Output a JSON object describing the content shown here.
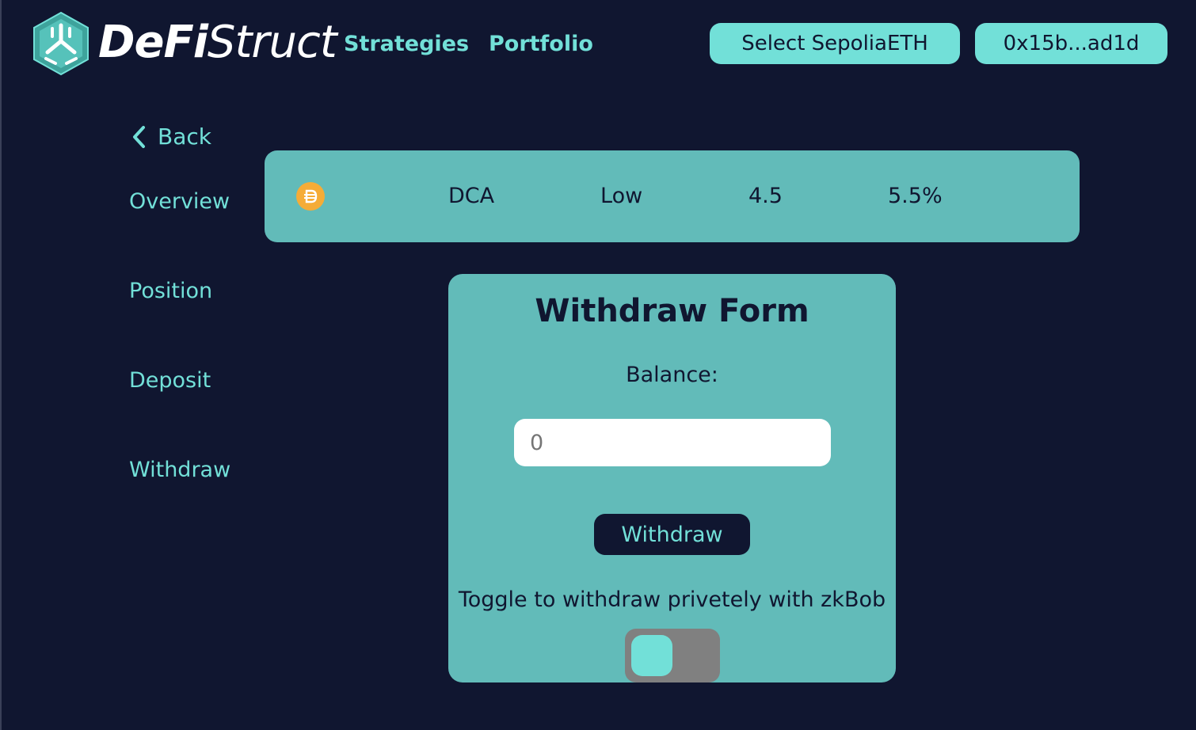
{
  "header": {
    "brand_bold": "DeFi",
    "brand_light": "Struct",
    "nav": {
      "strategies": "Strategies",
      "portfolio": "Portfolio"
    },
    "network_button": "Select SepoliaETH",
    "wallet_button": "0x15b...ad1d"
  },
  "sidebar": {
    "back": "Back",
    "items": [
      {
        "label": "Overview"
      },
      {
        "label": "Position"
      },
      {
        "label": "Deposit"
      },
      {
        "label": "Withdraw"
      }
    ]
  },
  "strategy": {
    "coin_icon": "dai-icon",
    "type": "DCA",
    "risk": "Low",
    "score": "4.5",
    "apy": "5.5%"
  },
  "form": {
    "title": "Withdraw Form",
    "balance_label": "Balance:",
    "input_placeholder": "0",
    "withdraw_label": "Withdraw",
    "toggle_label": "Toggle to withdraw privetely with zkBob",
    "toggle_on": false
  },
  "colors": {
    "background": "#101630",
    "accent": "#72e0d8",
    "card": "#62bbb9",
    "coin": "#f5ac37",
    "toggle_track": "#808080"
  }
}
